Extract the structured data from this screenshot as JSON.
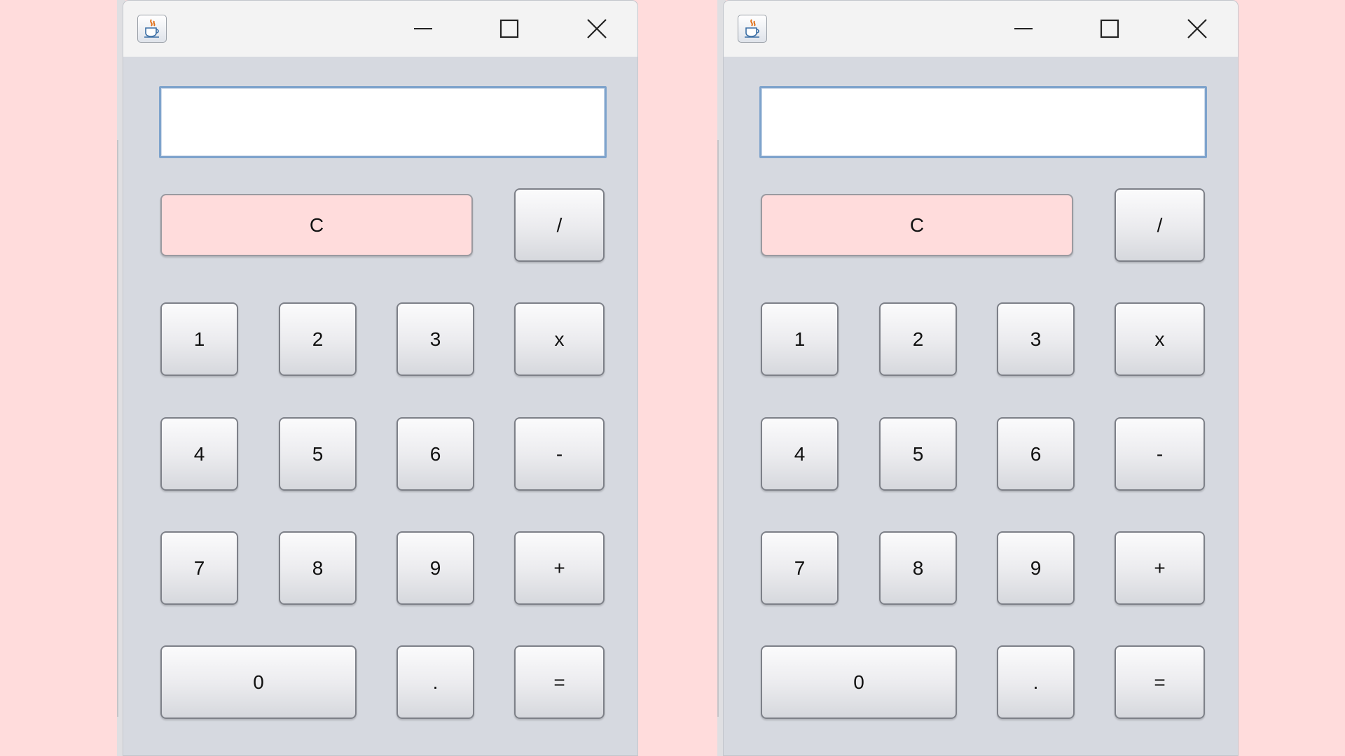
{
  "calculators": [
    {
      "display_value": "",
      "keys": {
        "clear": "C",
        "divide": "/",
        "one": "1",
        "two": "2",
        "three": "3",
        "multiply": "x",
        "four": "4",
        "five": "5",
        "six": "6",
        "minus": "-",
        "seven": "7",
        "eight": "8",
        "nine": "9",
        "plus": "+",
        "zero": "0",
        "decimal": ".",
        "equals": "="
      }
    },
    {
      "display_value": "",
      "keys": {
        "clear": "C",
        "divide": "/",
        "one": "1",
        "two": "2",
        "three": "3",
        "multiply": "x",
        "four": "4",
        "five": "5",
        "six": "6",
        "minus": "-",
        "seven": "7",
        "eight": "8",
        "nine": "9",
        "plus": "+",
        "zero": "0",
        "decimal": ".",
        "equals": "="
      }
    }
  ],
  "icons": {
    "app": "java-coffee-cup-icon",
    "minimize": "minimize-icon",
    "maximize": "maximize-icon",
    "close": "close-icon"
  },
  "colors": {
    "background": "#ffdcdc",
    "window_body": "#d6d9e0",
    "titlebar": "#f3f3f3",
    "clear_button": "#ffdcdc",
    "display_border": "#7ea3cc"
  }
}
